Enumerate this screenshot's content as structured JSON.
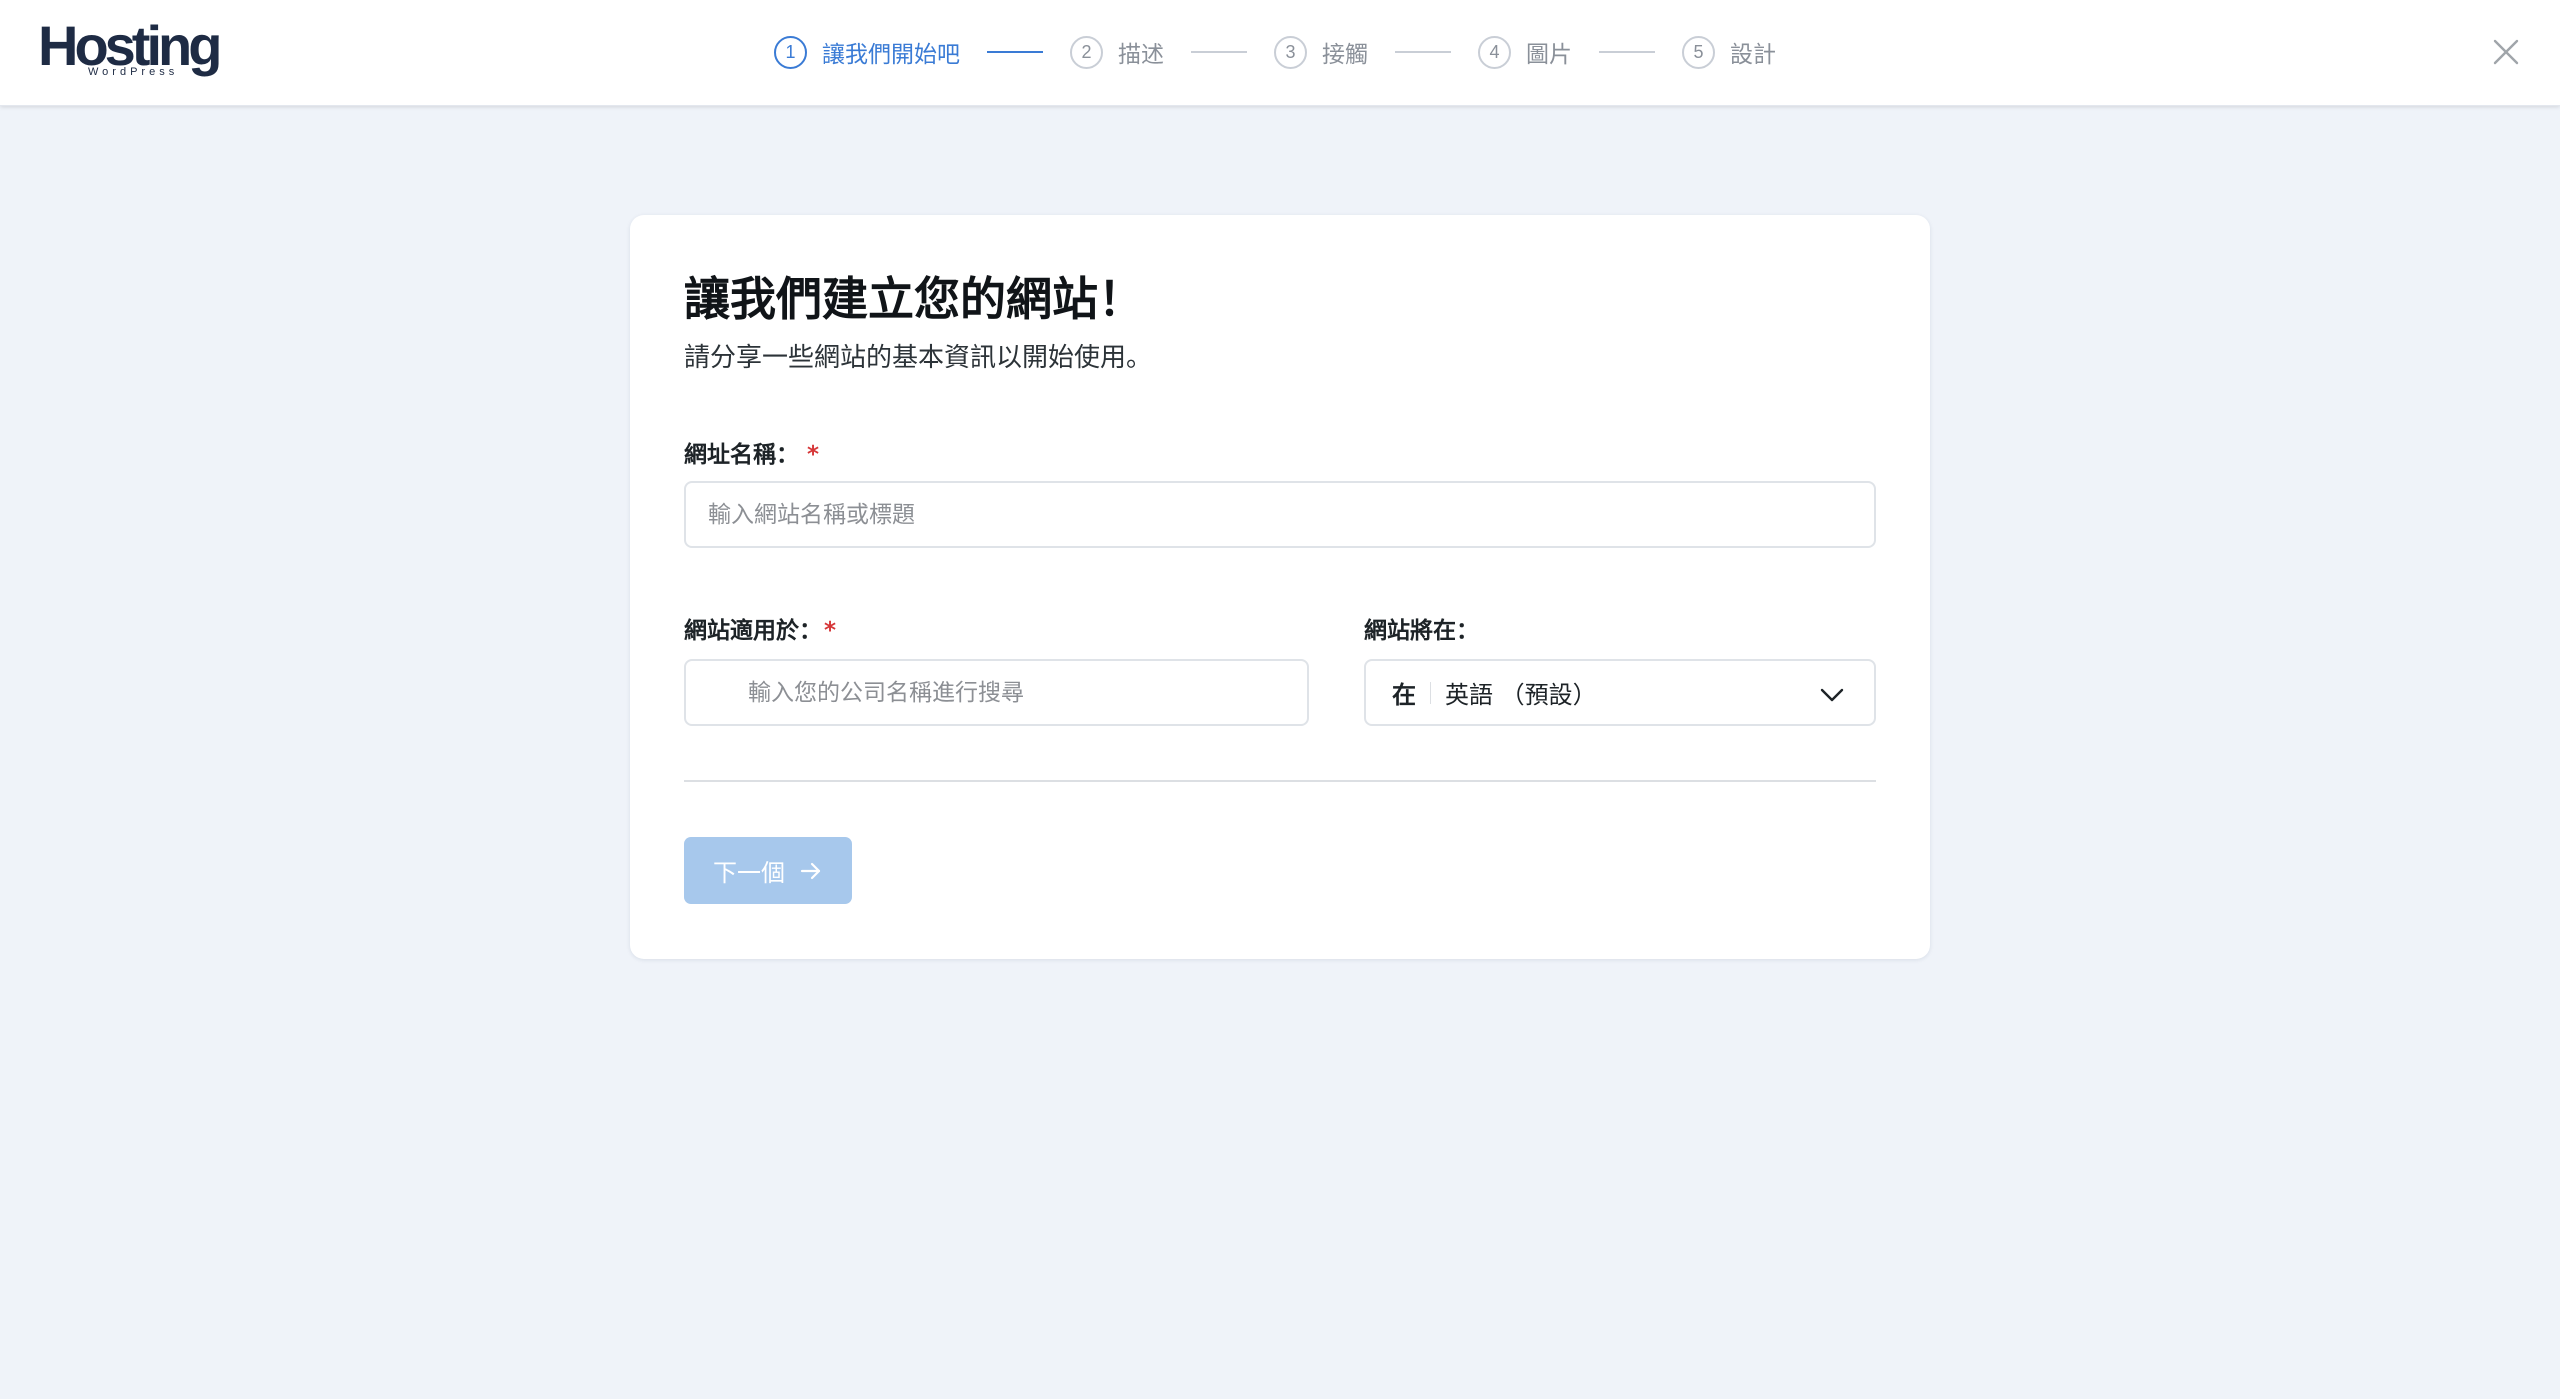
{
  "header": {
    "logo_text": "Hosting",
    "logo_subtext": "WordPress",
    "steps": [
      {
        "num": "1",
        "label": "讓我們開始吧"
      },
      {
        "num": "2",
        "label": "描述"
      },
      {
        "num": "3",
        "label": "接觸"
      },
      {
        "num": "4",
        "label": "圖片"
      },
      {
        "num": "5",
        "label": "設計"
      }
    ],
    "active_step": 1,
    "close_icon": "close-icon"
  },
  "form": {
    "title": "讓我們建立您的網站！",
    "subtitle": "請分享一些網站的基本資訊以開始使用。",
    "site_name_label": "網址名稱：",
    "site_name_required": "*",
    "site_name_placeholder": "輸入網站名稱或標題",
    "site_name_value": "",
    "site_for_label": "網站適用於：",
    "site_for_required": "*",
    "site_for_placeholder": "輸入您的公司名稱進行搜尋",
    "site_lang_label": "網站將在：",
    "site_lang_prefix": "在",
    "site_lang_value": "英語 （預設）",
    "next_label": "下一個"
  },
  "colors": {
    "accent": "#3a7bd5",
    "button_disabled": "#a7c8ec",
    "background": "#eff3f9",
    "required": "#d63638"
  }
}
